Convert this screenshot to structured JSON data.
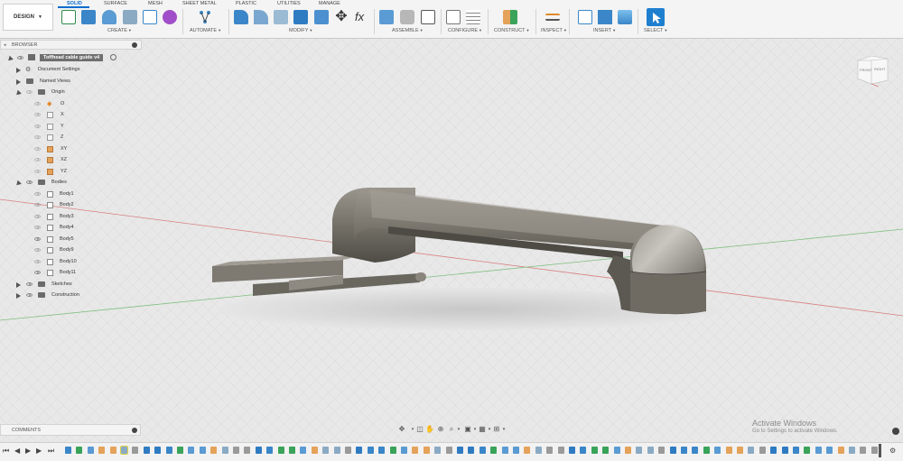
{
  "app": {
    "workspace": "DESIGN",
    "tabs": [
      "SOLID",
      "SURFACE",
      "MESH",
      "SHEET METAL",
      "PLASTIC",
      "UTILITIES",
      "MANAGE"
    ],
    "active_tab": "SOLID"
  },
  "toolbar": {
    "groups": [
      "CREATE",
      "AUTOMATE",
      "MODIFY",
      "ASSEMBLE",
      "CONFIGURE",
      "CONSTRUCT",
      "INSPECT",
      "INSERT",
      "SELECT"
    ],
    "accent": "#0a6ccd"
  },
  "browser": {
    "title": "BROWSER",
    "document": "Toffhead cable guide v4",
    "items": [
      {
        "label": "Document Settings",
        "icon": "gear-icon"
      },
      {
        "label": "Named Views",
        "icon": "folder-icon"
      },
      {
        "label": "Origin",
        "icon": "folder-icon"
      },
      {
        "label": "O",
        "icon": "origin-point-icon"
      },
      {
        "label": "X",
        "icon": "axis-icon"
      },
      {
        "label": "Y",
        "icon": "axis-icon"
      },
      {
        "label": "Z",
        "icon": "axis-icon"
      },
      {
        "label": "XY",
        "icon": "plane-icon"
      },
      {
        "label": "XZ",
        "icon": "plane-icon"
      },
      {
        "label": "YZ",
        "icon": "plane-icon"
      },
      {
        "label": "Bodies",
        "icon": "folder-icon"
      },
      {
        "label": "Body1",
        "icon": "body-icon"
      },
      {
        "label": "Body2",
        "icon": "body-icon"
      },
      {
        "label": "Body3",
        "icon": "body-icon"
      },
      {
        "label": "Body4",
        "icon": "body-icon"
      },
      {
        "label": "Body5",
        "icon": "body-icon"
      },
      {
        "label": "Body9",
        "icon": "body-icon"
      },
      {
        "label": "Body10",
        "icon": "body-icon"
      },
      {
        "label": "Body11",
        "icon": "body-icon"
      },
      {
        "label": "Sketches",
        "icon": "folder-icon"
      },
      {
        "label": "Construction",
        "icon": "folder-icon"
      }
    ]
  },
  "viewcube": {
    "front": "FRONT",
    "right": "RIGHT"
  },
  "comments": {
    "title": "COMMENTS"
  },
  "watermark": {
    "line1": "Activate Windows",
    "line2": "Go to Settings to activate Windows."
  }
}
